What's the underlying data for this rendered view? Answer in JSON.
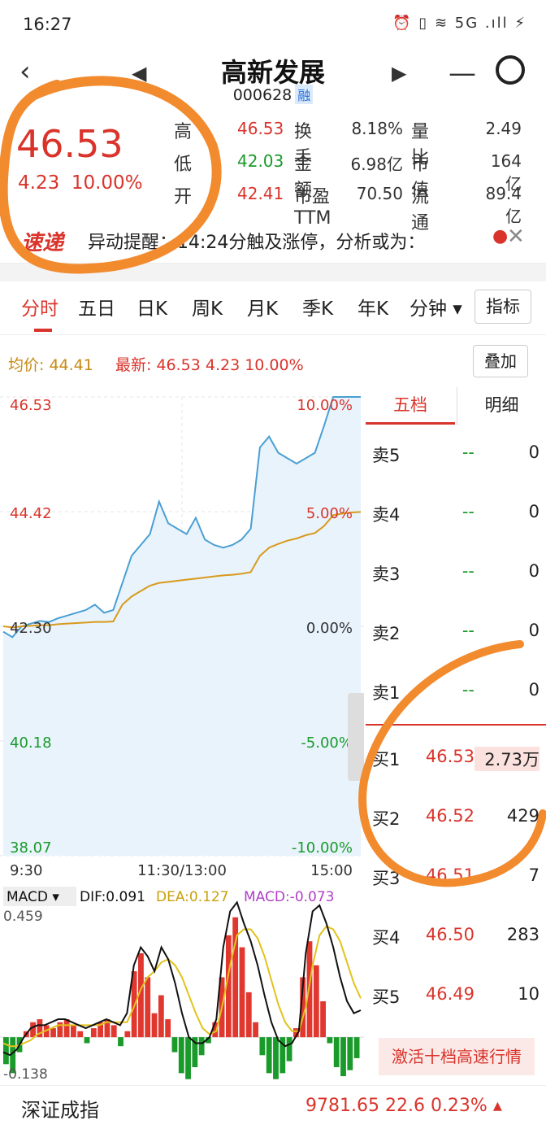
{
  "status_bar": {
    "time": "16:27",
    "icons": "⏰ ▯ ≋ 5G .ıll ⚡"
  },
  "header": {
    "back": "‹",
    "prev": "◀",
    "title": "高新发展",
    "code": "000628",
    "margin_badge": "融",
    "next": "▶",
    "menu": "—",
    "search": "Q"
  },
  "quote": {
    "price": "46.53",
    "change": "4.23",
    "change_pct": "10.00%",
    "rows": [
      [
        {
          "label": "高",
          "value": "46.53",
          "color": "red"
        },
        {
          "label": "换手",
          "value": "8.18%",
          "color": "gray"
        },
        {
          "label": "量比",
          "value": "2.49",
          "color": "gray"
        }
      ],
      [
        {
          "label": "低",
          "value": "42.03",
          "color": "green"
        },
        {
          "label": "金额",
          "value": "6.98亿",
          "color": "gray"
        },
        {
          "label": "市值",
          "value": "164亿",
          "color": "gray"
        }
      ],
      [
        {
          "label": "开",
          "value": "42.41",
          "color": "red"
        },
        {
          "label": "市盈TTM",
          "value": "70.50",
          "color": "gray"
        },
        {
          "label": "流通",
          "value": "89.4亿",
          "color": "gray"
        }
      ]
    ]
  },
  "speed": {
    "logo": "速递",
    "text": "异动提醒：14:24分触及涨停，分析或为：",
    "close": "✕"
  },
  "tabs": [
    "分时",
    "五日",
    "日K",
    "周K",
    "月K",
    "季K",
    "年K",
    "分钟 ▾"
  ],
  "indicator_button": "指标",
  "avg_line": {
    "avg": "均价: 44.41",
    "latest": "最新: 46.53 4.23 10.00%"
  },
  "overlay_button": "叠加",
  "chart_data": {
    "type": "line",
    "price_axis": {
      "left_ticks": [
        "46.53",
        "44.42",
        "42.30",
        "40.18",
        "38.07"
      ],
      "right_ticks": [
        "10.00%",
        "5.00%",
        "0.00%",
        "-5.00%",
        "-10.00%"
      ],
      "ylim": [
        38.07,
        46.53
      ]
    },
    "x_ticks": [
      "9:30",
      "11:30/13:00",
      "15:00"
    ],
    "series": [
      {
        "values": [
          42.2,
          42.1,
          42.3,
          42.35,
          42.4,
          42.38,
          42.45,
          42.5,
          42.55,
          42.6,
          42.7,
          42.55,
          42.6,
          43.1,
          43.6,
          43.8,
          44.0,
          44.6,
          44.2,
          44.1,
          44.0,
          44.3,
          43.9,
          43.8,
          43.75,
          43.8,
          43.9,
          44.1,
          45.6,
          45.8,
          45.5,
          45.4,
          45.3,
          45.4,
          45.5,
          46.0,
          46.53,
          46.53,
          46.53,
          46.53
        ]
      },
      {
        "values": [
          42.3,
          42.28,
          42.3,
          42.31,
          42.32,
          42.32,
          42.34,
          42.35,
          42.36,
          42.37,
          42.38,
          42.38,
          42.39,
          42.7,
          42.85,
          42.95,
          43.05,
          43.1,
          43.12,
          43.14,
          43.16,
          43.18,
          43.2,
          43.22,
          43.24,
          43.25,
          43.27,
          43.3,
          43.6,
          43.75,
          43.82,
          43.88,
          43.92,
          43.98,
          44.02,
          44.15,
          44.35,
          44.38,
          44.4,
          44.41
        ]
      }
    ]
  },
  "macd": {
    "label": "MACD ▾",
    "dif": "DIF:0.091",
    "dea": "DEA:0.127",
    "macd": "MACD:-0.073",
    "top": "0.459",
    "bottom": "-0.138",
    "ylim": [
      -0.138,
      0.459
    ],
    "bars": [
      -0.09,
      -0.12,
      -0.05,
      0.02,
      0.05,
      0.06,
      0.04,
      0.03,
      0.05,
      0.06,
      0.04,
      0.02,
      -0.02,
      0.03,
      0.05,
      0.06,
      0.04,
      -0.03,
      0.02,
      0.22,
      0.28,
      0.2,
      0.08,
      0.14,
      0.06,
      -0.05,
      -0.12,
      -0.14,
      -0.1,
      -0.06,
      -0.02,
      0.05,
      0.2,
      0.34,
      0.4,
      0.3,
      0.15,
      0.05,
      -0.06,
      -0.12,
      -0.14,
      -0.12,
      -0.08,
      0.03,
      0.2,
      0.32,
      0.24,
      0.12,
      -0.02,
      -0.1,
      -0.13,
      -0.11,
      -0.07
    ],
    "dif_line": [
      -0.05,
      -0.06,
      -0.04,
      0.0,
      0.03,
      0.04,
      0.04,
      0.05,
      0.06,
      0.06,
      0.05,
      0.04,
      0.03,
      0.04,
      0.05,
      0.06,
      0.05,
      0.04,
      0.08,
      0.24,
      0.3,
      0.27,
      0.22,
      0.3,
      0.26,
      0.18,
      0.08,
      0.0,
      -0.02,
      -0.02,
      0.0,
      0.06,
      0.3,
      0.42,
      0.45,
      0.38,
      0.32,
      0.24,
      0.14,
      0.05,
      -0.01,
      -0.03,
      -0.02,
      0.02,
      0.28,
      0.42,
      0.44,
      0.38,
      0.3,
      0.2,
      0.12,
      0.08,
      0.09
    ],
    "dea_line": [
      -0.02,
      -0.03,
      -0.03,
      -0.02,
      -0.01,
      0.01,
      0.02,
      0.03,
      0.04,
      0.04,
      0.04,
      0.04,
      0.04,
      0.04,
      0.04,
      0.05,
      0.05,
      0.05,
      0.05,
      0.1,
      0.16,
      0.2,
      0.22,
      0.25,
      0.26,
      0.24,
      0.2,
      0.14,
      0.08,
      0.03,
      0.01,
      0.02,
      0.12,
      0.24,
      0.34,
      0.36,
      0.36,
      0.33,
      0.27,
      0.19,
      0.11,
      0.05,
      0.02,
      0.02,
      0.1,
      0.24,
      0.34,
      0.37,
      0.36,
      0.32,
      0.25,
      0.18,
      0.13
    ]
  },
  "book": {
    "tabs": [
      "五档",
      "明细"
    ],
    "asks": [
      {
        "label": "卖5",
        "price": "--",
        "vol": "0"
      },
      {
        "label": "卖4",
        "price": "--",
        "vol": "0"
      },
      {
        "label": "卖3",
        "price": "--",
        "vol": "0"
      },
      {
        "label": "卖2",
        "price": "--",
        "vol": "0"
      },
      {
        "label": "卖1",
        "price": "--",
        "vol": "0"
      }
    ],
    "bids": [
      {
        "label": "买1",
        "price": "46.53",
        "vol": "2.73万"
      },
      {
        "label": "买2",
        "price": "46.52",
        "vol": "429"
      },
      {
        "label": "买3",
        "price": "46.51",
        "vol": "7"
      },
      {
        "label": "买4",
        "price": "46.50",
        "vol": "283"
      },
      {
        "label": "买5",
        "price": "46.49",
        "vol": "10"
      }
    ],
    "activate": "激活十档高速行情"
  },
  "bottom": {
    "name": "深证成指",
    "value": "9781.65  22.6  0.23% ▴"
  },
  "colors": {
    "red": "#d9342b",
    "green": "#1a9a2a",
    "price_line": "#4a9fd4",
    "avg_line": "#d99a1c",
    "annotation": "#f28a2e"
  }
}
